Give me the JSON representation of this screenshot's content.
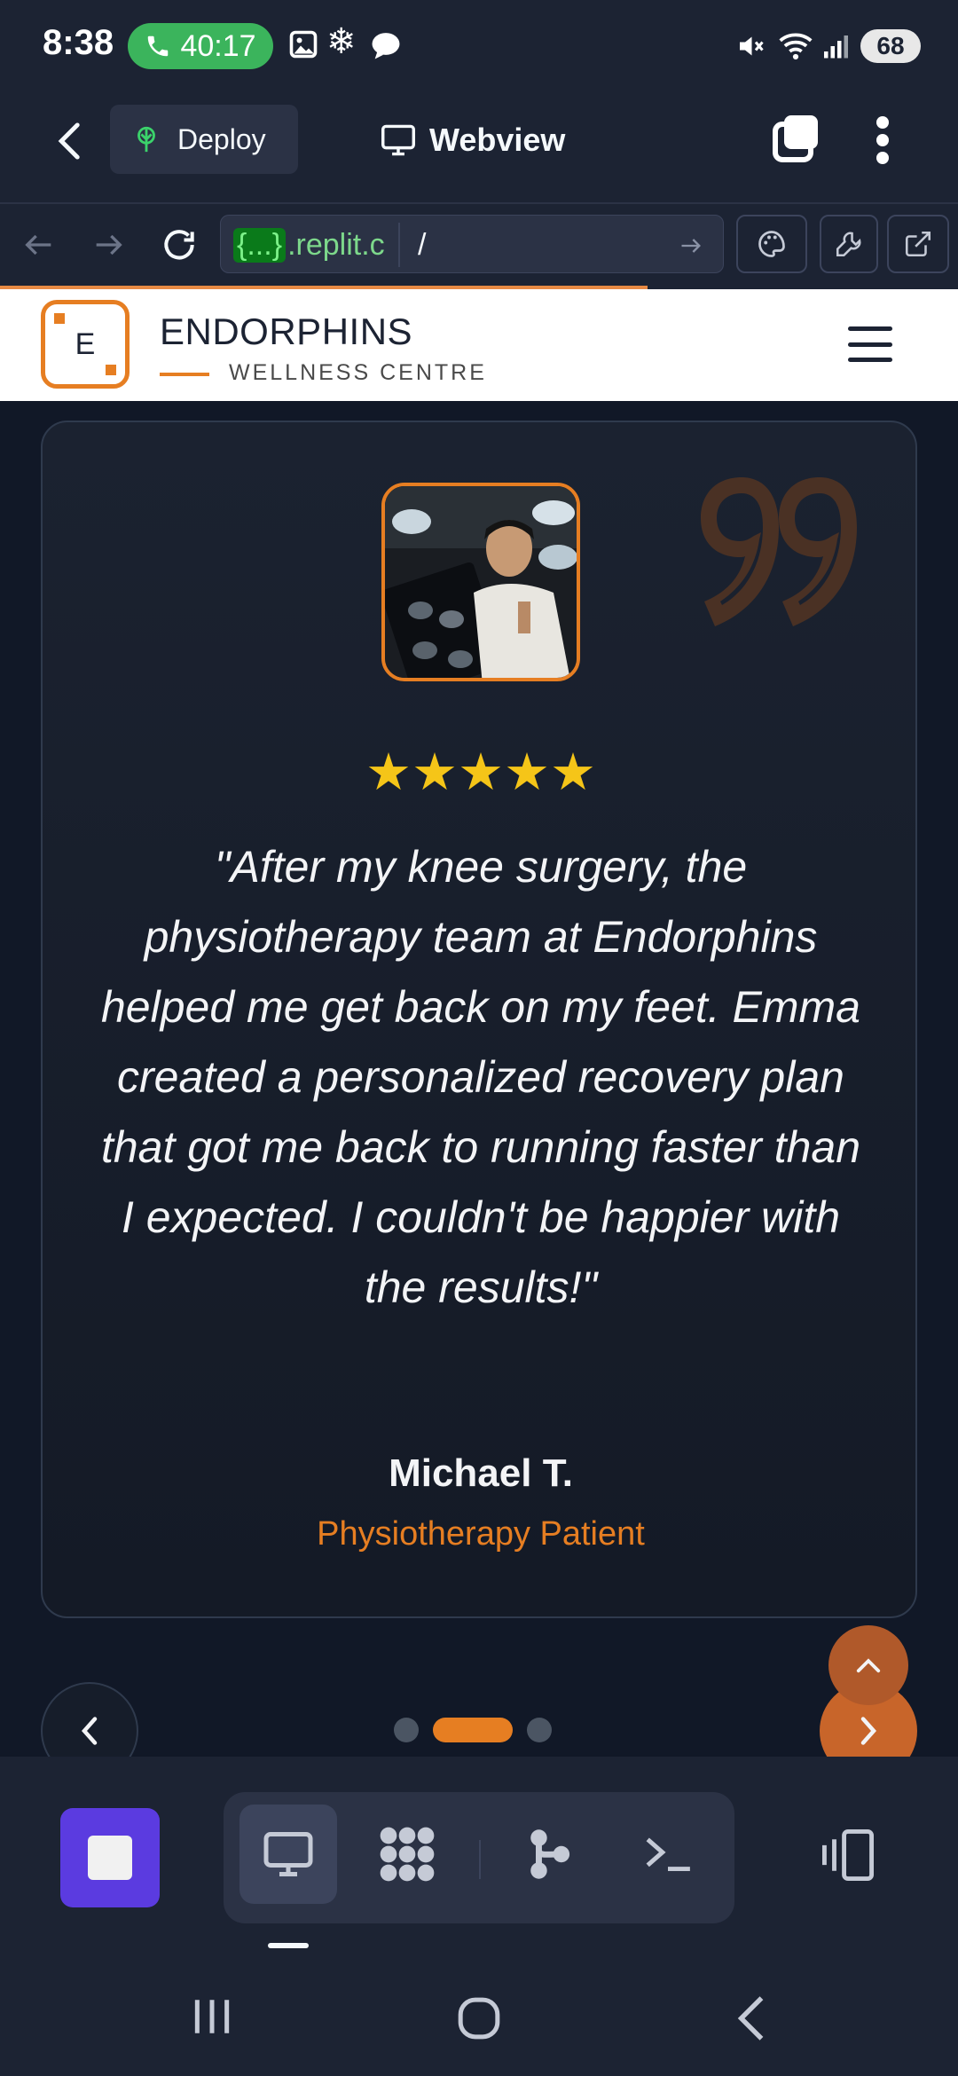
{
  "status_bar": {
    "time": "8:38",
    "call_timer": "40:17",
    "battery": "68"
  },
  "topbar": {
    "deploy_label": "Deploy",
    "webview_label": "Webview"
  },
  "urlbar": {
    "host_brace": "{...}",
    "host_domain": ".replit.c",
    "path": "/"
  },
  "site": {
    "logo_letter": "E",
    "brand_name": "ENDORPHINS",
    "brand_sub": "WELLNESS CENTRE"
  },
  "testimonial": {
    "rating": 5,
    "stars": "★★★★★",
    "quote": "\"After my knee surgery, the physiotherapy team at Endorphins helped me get back on my feet. Emma created a personalized recovery plan that got me back to running faster than I expected. I couldn't be happier with the results!\"",
    "author": "Michael T.",
    "role": "Physiotherapy Patient"
  },
  "carousel": {
    "total_slides": 3,
    "active_slide": 2
  },
  "colors": {
    "accent": "#e67e22",
    "background": "#111827",
    "replit_bar": "#1c2333",
    "stop_button": "#5b3be0",
    "star": "#f5c518"
  },
  "icons": {
    "back": "chevron-left-icon",
    "deploy": "deploy-icon",
    "webview": "monitor-icon",
    "tabs": "tabs-icon",
    "more": "kebab-icon",
    "reload": "reload-icon",
    "theme": "palette-icon",
    "devtools": "wrench-icon",
    "open_external": "external-link-icon"
  }
}
